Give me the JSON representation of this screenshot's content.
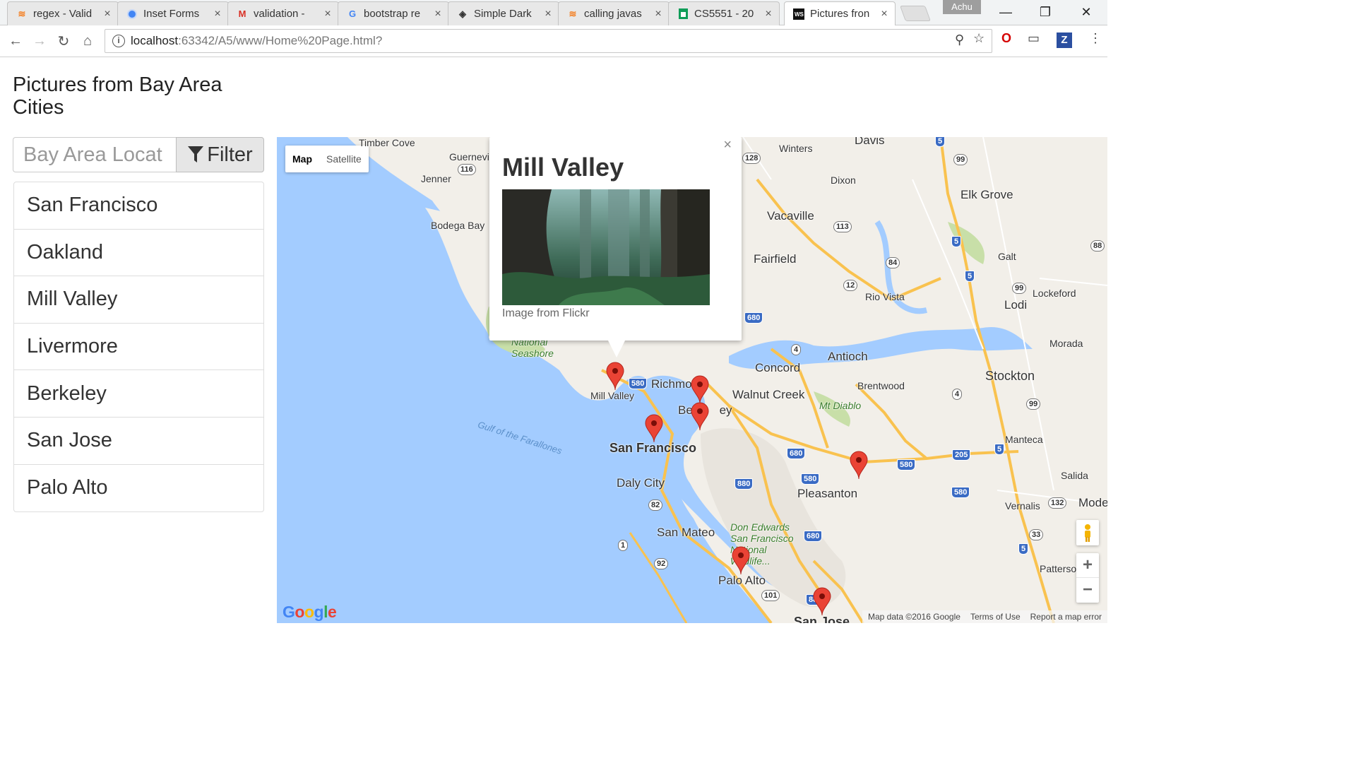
{
  "browser": {
    "tabs": [
      {
        "title": "regex - Valid",
        "icon": "stackoverflow-icon"
      },
      {
        "title": "Inset Forms",
        "icon": "chrome-icon"
      },
      {
        "title": "validation - ",
        "icon": "gmail-icon"
      },
      {
        "title": "bootstrap re",
        "icon": "google-icon"
      },
      {
        "title": "Simple Dark",
        "icon": "codepen-icon"
      },
      {
        "title": "calling javas",
        "icon": "stackoverflow-icon"
      },
      {
        "title": "CS5551 - 20",
        "icon": "sheets-icon"
      },
      {
        "title": "Pictures fron",
        "icon": "webstorm-icon"
      }
    ],
    "profile_name": "Achu",
    "url_host": "localhost",
    "url_path": ":63342/A5/www/Home%20Page.html?"
  },
  "page": {
    "title": "Pictures from Bay Area Cities",
    "filter": {
      "placeholder": "Bay Area Locat",
      "button_label": "Filter"
    },
    "cities": [
      "San Francisco",
      "Oakland",
      "Mill Valley",
      "Livermore",
      "Berkeley",
      "San Jose",
      "Palo Alto"
    ]
  },
  "map": {
    "type_controls": [
      "Map",
      "Satellite"
    ],
    "selected_type": "Map",
    "info_window": {
      "title": "Mill Valley",
      "caption": "Image from Flickr",
      "close": "×"
    },
    "labels": {
      "timber_cove": "Timber Cove",
      "guerneville": "Guernevil",
      "jenner": "Jenner",
      "bodega_bay": "Bodega Bay",
      "winters": "Winters",
      "davis": "Davis",
      "dixon": "Dixon",
      "elk_grove": "Elk Grove",
      "vacaville": "Vacaville",
      "fairfield": "Fairfield",
      "galt": "Galt",
      "rio_vista": "Rio Vista",
      "lockeford": "Lockeford",
      "lodi": "Lodi",
      "morada": "Morada",
      "antioch": "Antioch",
      "concord": "Concord",
      "brentwood": "Brentwood",
      "stockton": "Stockton",
      "national_seashore": "National\nSeashore",
      "richmond": "Richmor",
      "walnut_creek": "Walnut Creek",
      "mt_diablo": "Mt Diablo",
      "mill_valley": "Mill Valley",
      "berkeley": "Be        ey",
      "san_francisco": "San Francisco",
      "gulf": "Gulf of the Farallones",
      "manteca": "Manteca",
      "daly_city": "Daly City",
      "pleasanton": "Pleasanton",
      "salida": "Salida",
      "vernalis": "Vernalis",
      "modesto": "Mode",
      "san_mateo": "San Mateo",
      "don_edwards": "Don Edwards\nSan Francisco\nNational\nWildlife...",
      "patterson": "Patterso",
      "palo_alto": "Palo Alto",
      "san_jose": "San Jose"
    },
    "shields": [
      "128",
      "5",
      "99",
      "116",
      "113",
      "5",
      "88",
      "84",
      "5",
      "12",
      "99",
      "680",
      "4",
      "580",
      "4",
      "99",
      "680",
      "205",
      "5",
      "580",
      "580",
      "880",
      "580",
      "82",
      "132",
      "1",
      "680",
      "33",
      "92",
      "5",
      "101",
      "880"
    ],
    "attribution": [
      "Map data ©2016 Google",
      "Terms of Use",
      "Report a map error"
    ],
    "logo": "Google",
    "colors": {
      "water": "#a3ccff",
      "land": "#f2efe9",
      "park": "#c8dfa8",
      "pin": "#ea4335",
      "highway": "#f9c24f"
    }
  }
}
